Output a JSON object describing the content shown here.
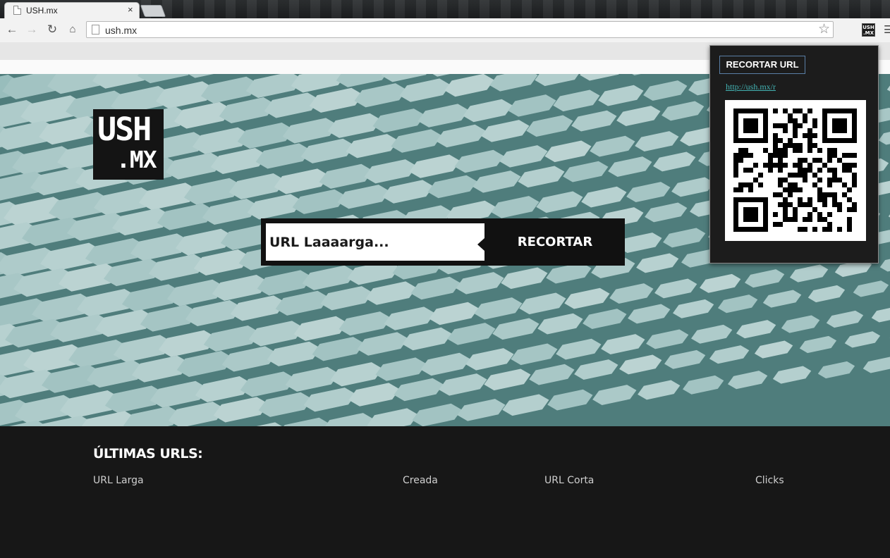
{
  "browser": {
    "tab_title": "USH.mx",
    "tab_close": "×",
    "address": "ush.mx",
    "icons": {
      "back": "back-arrow-icon",
      "forward": "forward-arrow-icon",
      "reload": "reload-icon",
      "home": "home-icon",
      "bookmark": "star-icon",
      "menu": "menu-icon",
      "extension": "ush-extension-icon"
    }
  },
  "logo": {
    "line1": "USH",
    "line2": ".MX"
  },
  "shorten_form": {
    "placeholder": "URL Laaaarga...",
    "button_label": "RECORTAR"
  },
  "footer": {
    "heading": "ÚLTIMAS URLS:",
    "columns": [
      "URL Larga",
      "Creada",
      "URL Corta",
      "Clicks"
    ]
  },
  "popup": {
    "button_label": "RECORTAR URL",
    "short_link": "http://ush.mx/r"
  },
  "colors": {
    "hero_background": "#6e9a99",
    "dark": "#171717",
    "link": "#43b3b3"
  }
}
